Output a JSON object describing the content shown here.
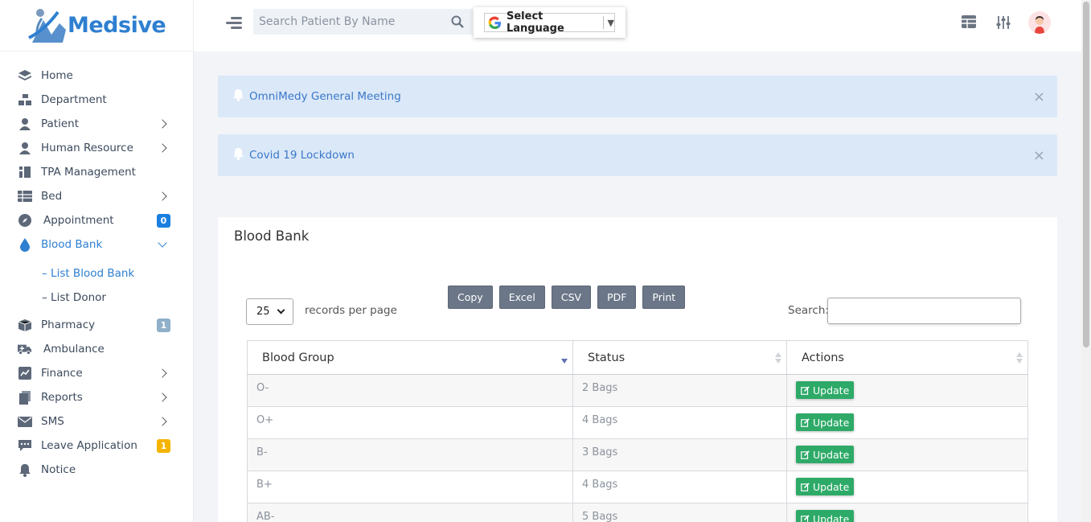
{
  "brand": {
    "name": "Medsive"
  },
  "sidebar": {
    "items": [
      {
        "label": "Home",
        "icon": "layers-icon"
      },
      {
        "label": "Department",
        "icon": "sitemap-icon"
      },
      {
        "label": "Patient",
        "icon": "user-icon",
        "chevron": true
      },
      {
        "label": "Human Resource",
        "icon": "user-icon",
        "chevron": true
      },
      {
        "label": "TPA Management",
        "icon": "list-icon"
      },
      {
        "label": "Bed",
        "icon": "table-icon",
        "chevron": true
      },
      {
        "label": "Appointment",
        "icon": "compass-icon",
        "badge": "0"
      },
      {
        "label": "Blood Bank",
        "icon": "drop-icon",
        "chevron": true
      },
      {
        "label": "Pharmacy",
        "icon": "box-icon",
        "badge": "1"
      },
      {
        "label": "Ambulance",
        "icon": "ambulance-icon"
      },
      {
        "label": "Finance",
        "icon": "chart-icon",
        "chevron": true
      },
      {
        "label": "Reports",
        "icon": "file-icon",
        "chevron": true
      },
      {
        "label": "SMS",
        "icon": "mail-icon",
        "chevron": true
      },
      {
        "label": "Leave Application",
        "icon": "comment-icon",
        "badge": "1"
      },
      {
        "label": "Notice",
        "icon": "bell-icon"
      }
    ],
    "blood_bank_sub": [
      {
        "label": "–  List Blood Bank"
      },
      {
        "label": "– List Donor"
      }
    ]
  },
  "header": {
    "search_placeholder": "Search Patient By Name",
    "language_label": "Select Language"
  },
  "alerts": [
    {
      "text": "OmniMedy General Meeting",
      "close": "×"
    },
    {
      "text": "Covid 19 Lockdown",
      "close": "×"
    }
  ],
  "card": {
    "title": "Blood Bank",
    "page_length": "25",
    "page_length_label": "records per page",
    "buttons": [
      "Copy",
      "Excel",
      "CSV",
      "PDF",
      "Print"
    ],
    "search_label": "Search:",
    "columns": [
      "Blood Group",
      "Status",
      "Actions"
    ],
    "action_label": "Update",
    "rows": [
      {
        "group": "O-",
        "status": "2 Bags"
      },
      {
        "group": "O+",
        "status": "4 Bags"
      },
      {
        "group": "B-",
        "status": "3 Bags"
      },
      {
        "group": "B+",
        "status": "4 Bags"
      },
      {
        "group": "AB-",
        "status": "5 Bags"
      }
    ]
  },
  "colors": {
    "brand": "#2e7fd0",
    "update_button": "#2eaa68",
    "alert_bg": "#dbe8f8"
  }
}
